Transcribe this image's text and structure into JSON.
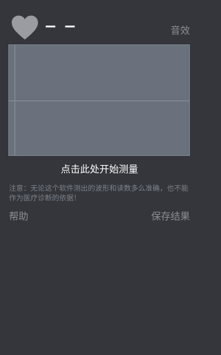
{
  "header": {
    "heart_icon": "heart-icon",
    "bpm_value": "− −",
    "sound_label": "音效"
  },
  "wave_panel": {
    "start_label": "点击此处开始测量"
  },
  "notice": {
    "text": "注意：无论这个软件测出的波形和读数多么准确，也不能作为医疗诊断的依据！"
  },
  "footer": {
    "help_label": "帮助",
    "save_label": "保存结果"
  },
  "colors": {
    "background": "#34363b",
    "panel": "#6a707c",
    "muted_text": "#8b8e96",
    "heart": "#9a9ca1"
  }
}
